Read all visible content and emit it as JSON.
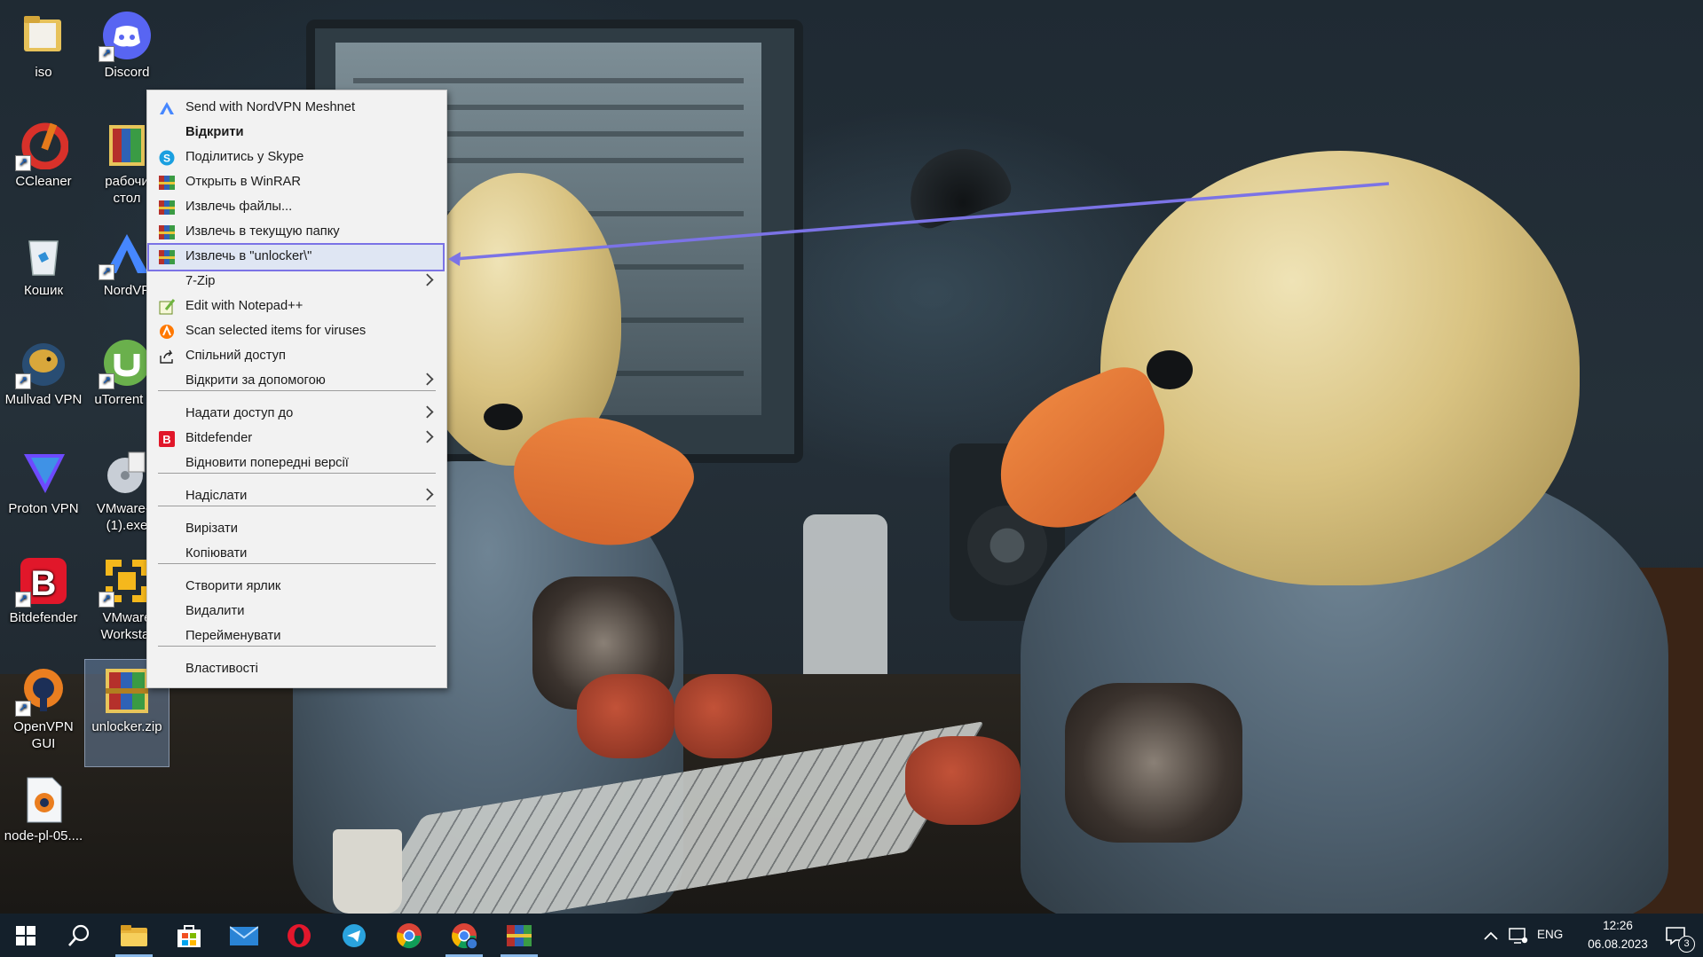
{
  "desktop": {
    "icons": [
      {
        "id": "iso",
        "label": "iso",
        "shortcut": false
      },
      {
        "id": "discord",
        "label": "Discord",
        "shortcut": true
      },
      {
        "id": "ccleaner",
        "label": "CCleaner",
        "shortcut": true
      },
      {
        "id": "rabochiy",
        "label": "рабочи\nстол",
        "shortcut": false
      },
      {
        "id": "koshyk",
        "label": "Кошик",
        "shortcut": false
      },
      {
        "id": "nordvpn",
        "label": "NordVP",
        "shortcut": true
      },
      {
        "id": "mullvad",
        "label": "Mullvad VPN",
        "shortcut": true
      },
      {
        "id": "utorrent",
        "label": "uTorrent W",
        "shortcut": true
      },
      {
        "id": "protonvpn",
        "label": "Proton VPN",
        "shortcut": false
      },
      {
        "id": "vmware_exe",
        "label": "VMware-p\n(1).exe",
        "shortcut": false
      },
      {
        "id": "bitdefender",
        "label": "Bitdefender",
        "shortcut": true
      },
      {
        "id": "vmware_ws",
        "label": "VMware\nWorkstat",
        "shortcut": true
      },
      {
        "id": "openvpn",
        "label": "OpenVPN\nGUI",
        "shortcut": true
      },
      {
        "id": "unlocker",
        "label": "unlocker.zip",
        "shortcut": false,
        "selected": true
      },
      {
        "id": "nodepl",
        "label": "node-pl-05....",
        "shortcut": false
      }
    ]
  },
  "context_menu": {
    "items": [
      {
        "label": "Send with NordVPN Meshnet",
        "icon": "nordvpn-icon"
      },
      {
        "label": "Відкрити",
        "bold": true
      },
      {
        "label": "Поділитись у Skype",
        "icon": "skype-icon"
      },
      {
        "label": "Открыть в WinRAR",
        "icon": "winrar-icon"
      },
      {
        "label": "Извлечь файлы...",
        "icon": "winrar-icon"
      },
      {
        "label": "Извлечь в текущую папку",
        "icon": "winrar-icon"
      },
      {
        "label": "Извлечь в \"unlocker\\\"",
        "icon": "winrar-icon",
        "highlighted": true
      },
      {
        "label": "7-Zip",
        "submenu": true
      },
      {
        "label": "Edit with Notepad++",
        "icon": "notepadpp-icon"
      },
      {
        "label": "Scan selected items for viruses",
        "icon": "avast-icon"
      },
      {
        "label": "Спільний доступ",
        "icon": "share-icon"
      },
      {
        "label": "Відкрити за допомогою",
        "submenu": true
      },
      {
        "label": "Надати доступ до",
        "submenu": true
      },
      {
        "label": "Bitdefender",
        "icon": "bitdefender-icon",
        "submenu": true
      },
      {
        "label": "Відновити попередні версії"
      },
      {
        "label": "Надіслати",
        "submenu": true
      },
      {
        "label": "Вирізати"
      },
      {
        "label": "Копіювати"
      },
      {
        "label": "Створити ярлик"
      },
      {
        "label": "Видалити"
      },
      {
        "label": "Перейменувати"
      },
      {
        "label": "Властивості"
      }
    ]
  },
  "annotation": {
    "color": "#7b73e6"
  },
  "taskbar": {
    "apps": [
      "start-icon",
      "search-icon",
      "file-explorer-icon",
      "microsoft-store-icon",
      "mail-icon",
      "opera-icon",
      "telegram-icon",
      "chrome-icon",
      "chrome-profile-icon",
      "winrar-icon"
    ],
    "language": "ENG",
    "time": "12:26",
    "date": "06.08.2023",
    "notification_count": "3"
  }
}
